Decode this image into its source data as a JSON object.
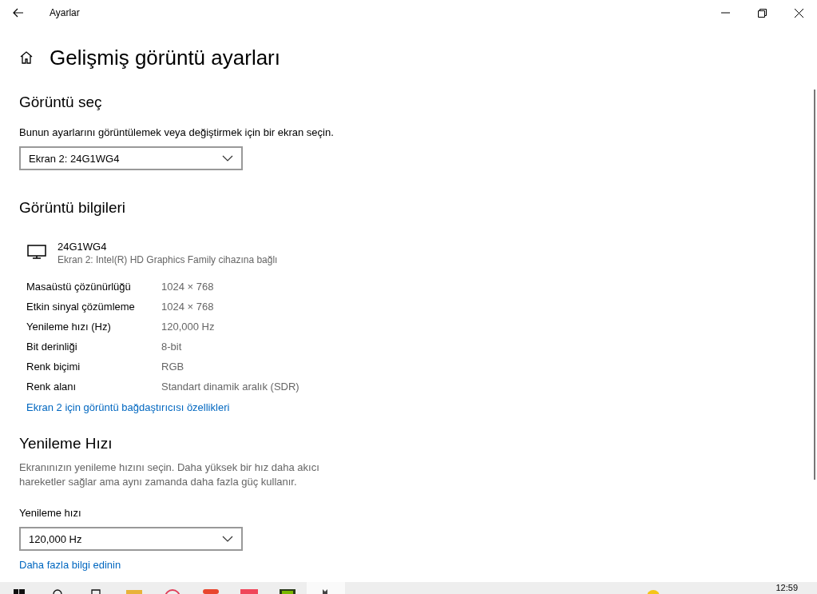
{
  "window": {
    "title": "Ayarlar"
  },
  "page_title": "Gelişmiş görüntü ayarları",
  "select_display": {
    "heading": "Görüntü seç",
    "description": "Bunun ayarlarını görüntülemek veya değiştirmek için bir ekran seçin.",
    "dropdown": {
      "value": "Ekran 2: 24G1WG4"
    }
  },
  "display_info": {
    "heading": "Görüntü bilgileri",
    "monitor_name": "24G1WG4",
    "monitor_subtitle": "Ekran 2: Intel(R) HD Graphics Family cihazına bağlı",
    "rows": [
      {
        "label": "Masaüstü çözünürlüğü",
        "value": "1024 × 768"
      },
      {
        "label": "Etkin sinyal çözümleme",
        "value": "1024 × 768"
      },
      {
        "label": "Yenileme hızı (Hz)",
        "value": "120,000 Hz"
      },
      {
        "label": "Bit derinliği",
        "value": "8-bit"
      },
      {
        "label": "Renk biçimi",
        "value": "RGB"
      },
      {
        "label": "Renk alanı",
        "value": "Standart dinamik aralık (SDR)"
      }
    ],
    "link": "Ekran 2 için görüntü bağdaştırıcısı özellikleri"
  },
  "refresh_rate": {
    "heading": "Yenileme Hızı",
    "description": "Ekranınızın yenileme hızını seçin. Daha yüksek bir hız daha akıcı hareketler sağlar ama aynı zamanda daha fazla güç kullanır.",
    "field_label": "Yenileme hızı",
    "dropdown": {
      "value": "120,000 Hz"
    },
    "link": "Daha fazla bilgi edinin"
  },
  "taskbar": {
    "clock": "12:59"
  }
}
